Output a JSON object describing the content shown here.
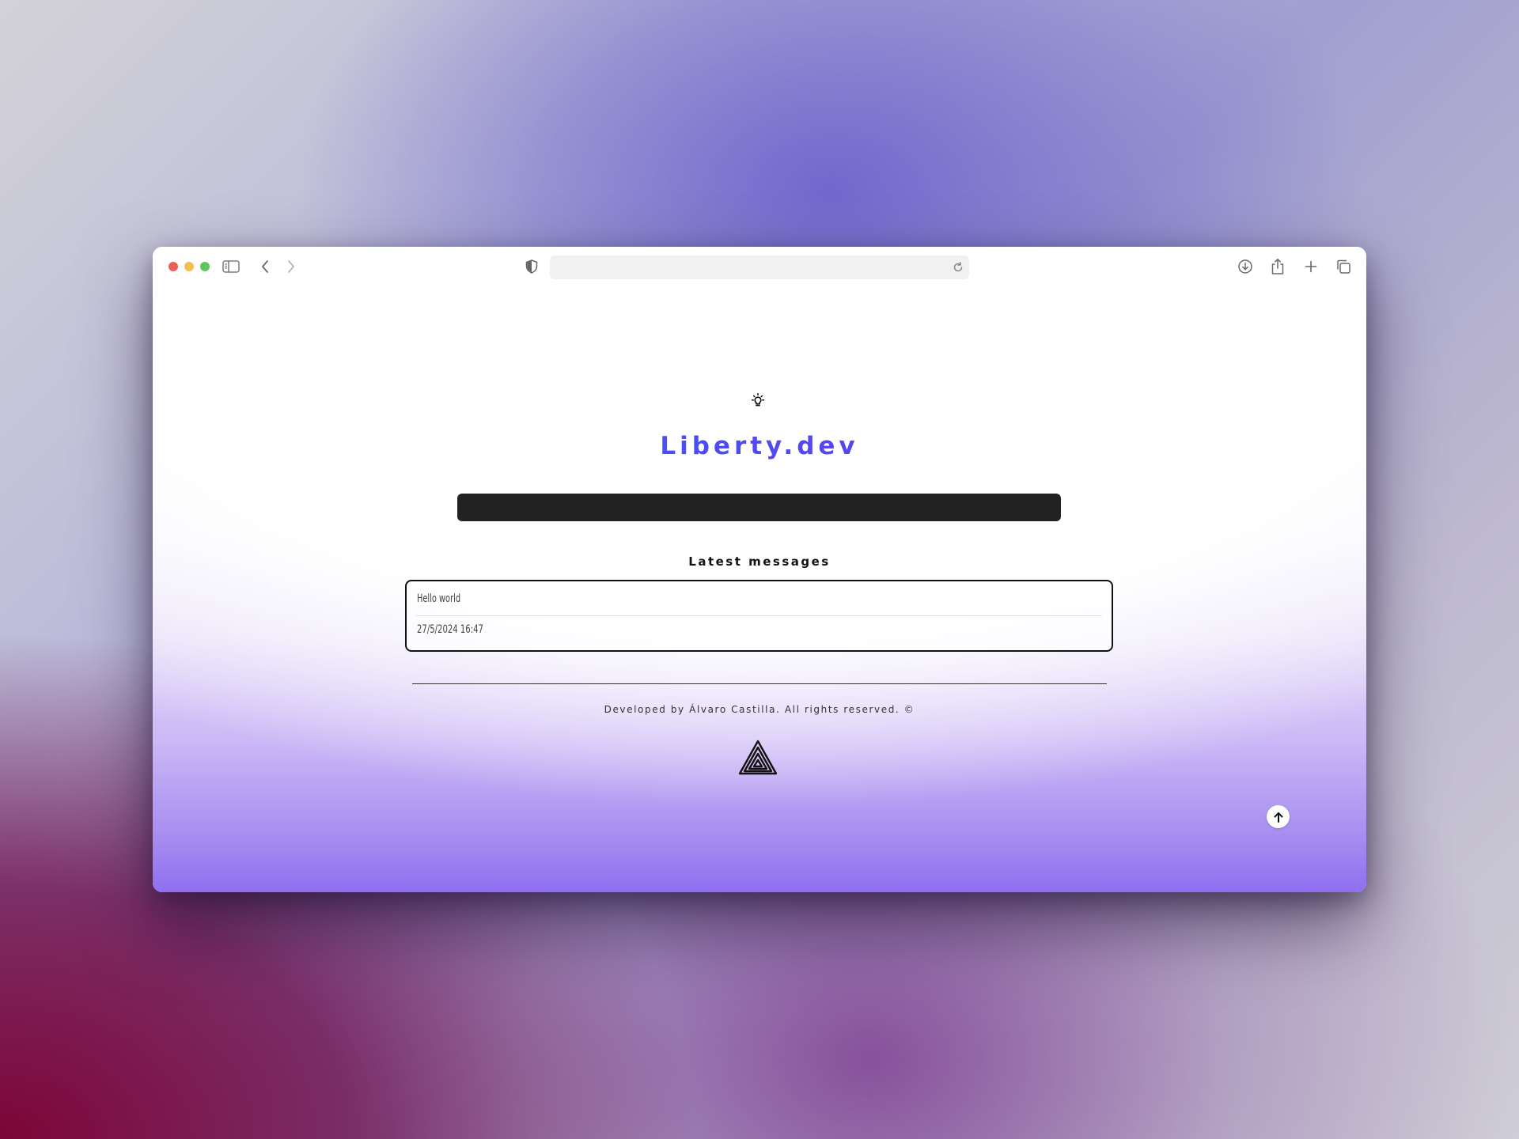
{
  "browser": {
    "url": "",
    "icons": {
      "sidebar": "sidebar-icon",
      "back": "chevron-left-icon",
      "forward": "chevron-right-icon",
      "privacy": "shield-icon",
      "reload": "reload-icon",
      "download": "download-icon",
      "share": "share-icon",
      "new_tab": "plus-icon",
      "tabs": "tabs-overview-icon"
    }
  },
  "page": {
    "theme_toggle_icon": "lightbulb-icon",
    "title": "Liberty.dev",
    "title_gradient": [
      "#2c6cf4",
      "#7a2df0"
    ],
    "message_input": {
      "value": "",
      "placeholder": ""
    },
    "latest_heading": "Latest messages",
    "messages": [
      {
        "text": "Hello world",
        "date": "27/5/2024 16:47"
      }
    ],
    "footer": {
      "credit": "Developed by Álvaro Castilla. All rights reserved. ©",
      "logo_icon": "penrose-triangle-logo"
    },
    "scroll_top_icon": "arrow-up-icon"
  }
}
